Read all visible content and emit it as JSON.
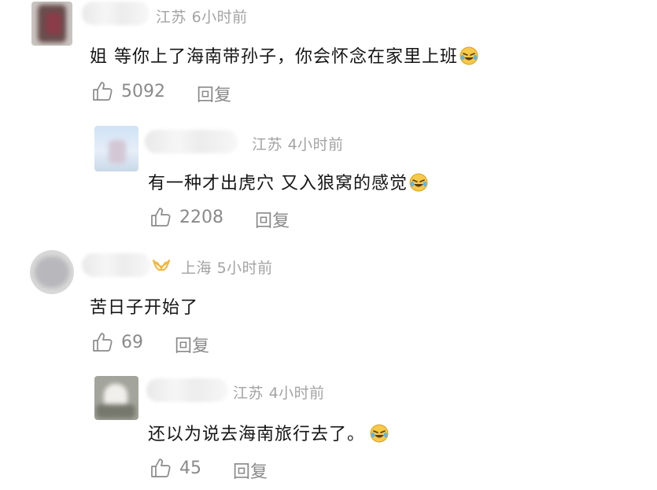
{
  "comments": [
    {
      "location": "江苏",
      "time": "6小时前",
      "text": "姐 等你上了海南带孙子，你会怀念在家里上班",
      "emoji": "laughing-tears-emoji",
      "likes": "5092",
      "reply_label": "回复",
      "replies": [
        {
          "location": "江苏",
          "time": "4小时前",
          "text": "有一种才出虎穴 又入狼窝的感觉",
          "emoji": "laughing-tears-emoji",
          "likes": "2208",
          "reply_label": "回复"
        }
      ]
    },
    {
      "location": "上海",
      "time": "5小时前",
      "text": "苦日子开始了",
      "likes": "69",
      "reply_label": "回复",
      "badge_icon": "vip-icon",
      "badge_color": "#f5b335",
      "replies": [
        {
          "location": "江苏",
          "time": "4小时前",
          "text": "还以为说去海南旅行去了。",
          "emoji": "laughing-tears-emoji",
          "likes": "45",
          "reply_label": "回复"
        }
      ]
    }
  ]
}
